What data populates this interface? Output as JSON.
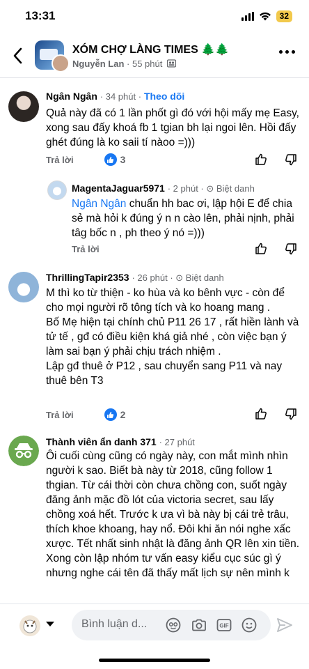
{
  "status_bar": {
    "time": "13:31",
    "battery": "32"
  },
  "header": {
    "group_name": "XÓM CHỢ LÀNG TIMES 🌲🌲",
    "author": "Nguyễn Lan",
    "separator": " · ",
    "time": "55 phút",
    "privacy_icon": "group-icon"
  },
  "comments": [
    {
      "name": "Ngân Ngân",
      "time": "· 34 phút ·",
      "follow": "Theo dõi",
      "text": "Quả này đã có 1 lần phốt gì đó với hội mấy mẹ Easy, xong sau đấy khoá fb 1 tgian bh lại ngoi lên. Hồi đấy ghét đúng là ko saii tí nàoo =)))",
      "reply_label": "Trả lời",
      "likes": "3"
    },
    {
      "name": "MagentaJaguar5971",
      "time": "· 2 phút · ⊙ Biệt danh",
      "mention": "Ngân Ngân",
      "text": " chuẩn hh bac ơi, lập hội E để chia sẻ mà hỏi k đúng ý n n cào lên, phải nịnh, phải tâg bốc n , ph theo ý nó =)))",
      "reply_label": "Trả lời"
    },
    {
      "name": "ThrillingTapir2353",
      "time": "· 26 phút · ⊙ Biệt danh",
      "text": "M thì ko từ thiện - ko hùa và ko bênh vực - còn để cho mọi người rõ tông tích và ko hoang mang .\nBố Mẹ hiện tại chính chủ P11 26 17 , rất hiền lành và tử tế , gđ có điều kiện khá giả nhé , còn việc bạn ý làm sai bạn ý phải chịu trách nhiệm .\nLập gđ thuê ở P12 , sau chuyển sang P11 và nay thuê bên T3",
      "reply_label": "Trả lời",
      "likes": "2"
    },
    {
      "name": "Thành viên ẩn danh 371",
      "time": "· 27 phút",
      "text": "Ôi cuối cùng cũng có ngày này, con mắt mình nhìn người k sao. Biết bà này từ 2018, cũng follow 1 thgian. Từ cái thời còn chưa chồng con, suốt ngày đăng ảnh mặc đồ lót của victoria secret, sau lấy chồng xoá hết. Trước k ưa vì bà này bị cái trẻ trâu, thích khoe khoang, hay nổ. Đôi khi ăn nói nghe xấc xược. Tết nhất sinh nhật là đăng ảnh QR lên xin tiền. Xong còn lập nhóm tư vấn easy kiểu cục súc gì ý nhưng nghe cái tên đã thấy mất lịch sự nên mình k"
    }
  ],
  "composer": {
    "placeholder": "Bình luận d..."
  },
  "colors": {
    "accent": "#1877f2",
    "muted": "#65676b",
    "text": "#050505"
  }
}
